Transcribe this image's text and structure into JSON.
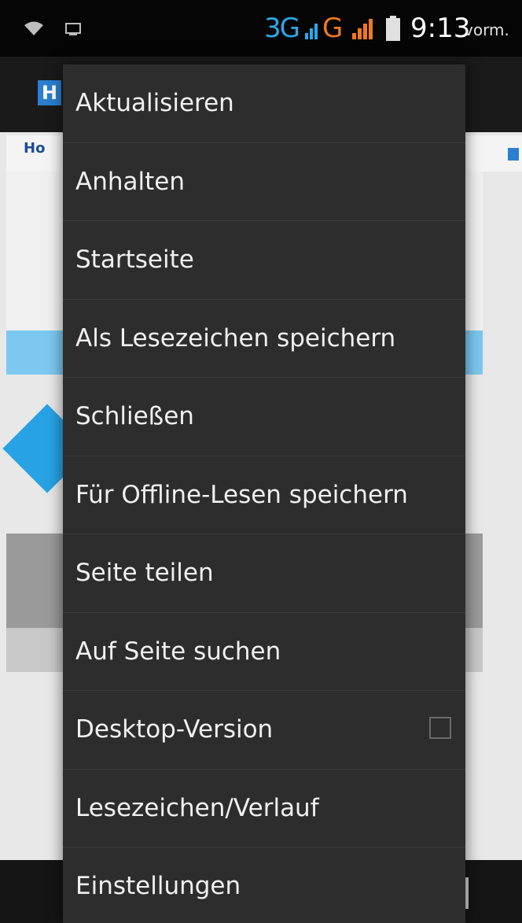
{
  "status_bar": {
    "network_3g": "3G",
    "network_g": "G",
    "time": "9:13",
    "ampm": "vorm.",
    "icons": [
      "wifi-icon",
      "screenshot-icon",
      "signal-icon",
      "battery-icon"
    ],
    "colors": {
      "network_3g": "#2aa8e8",
      "network_g": "#f07a1c"
    }
  },
  "app_bar": {
    "logo_letter": "H"
  },
  "web_page": {
    "logo_text": "Ho"
  },
  "menu": {
    "items": [
      {
        "label": "Aktualisieren"
      },
      {
        "label": "Anhalten"
      },
      {
        "label": "Startseite"
      },
      {
        "label": "Als Lesezeichen speichern"
      },
      {
        "label": "Schließen"
      },
      {
        "label": "Für Offline-Lesen speichern"
      },
      {
        "label": "Seite teilen"
      },
      {
        "label": "Auf Seite suchen"
      },
      {
        "label": "Desktop-Version",
        "checkbox": false
      },
      {
        "label": "Lesezeichen/Verlauf"
      },
      {
        "label": "Einstellungen"
      }
    ]
  }
}
